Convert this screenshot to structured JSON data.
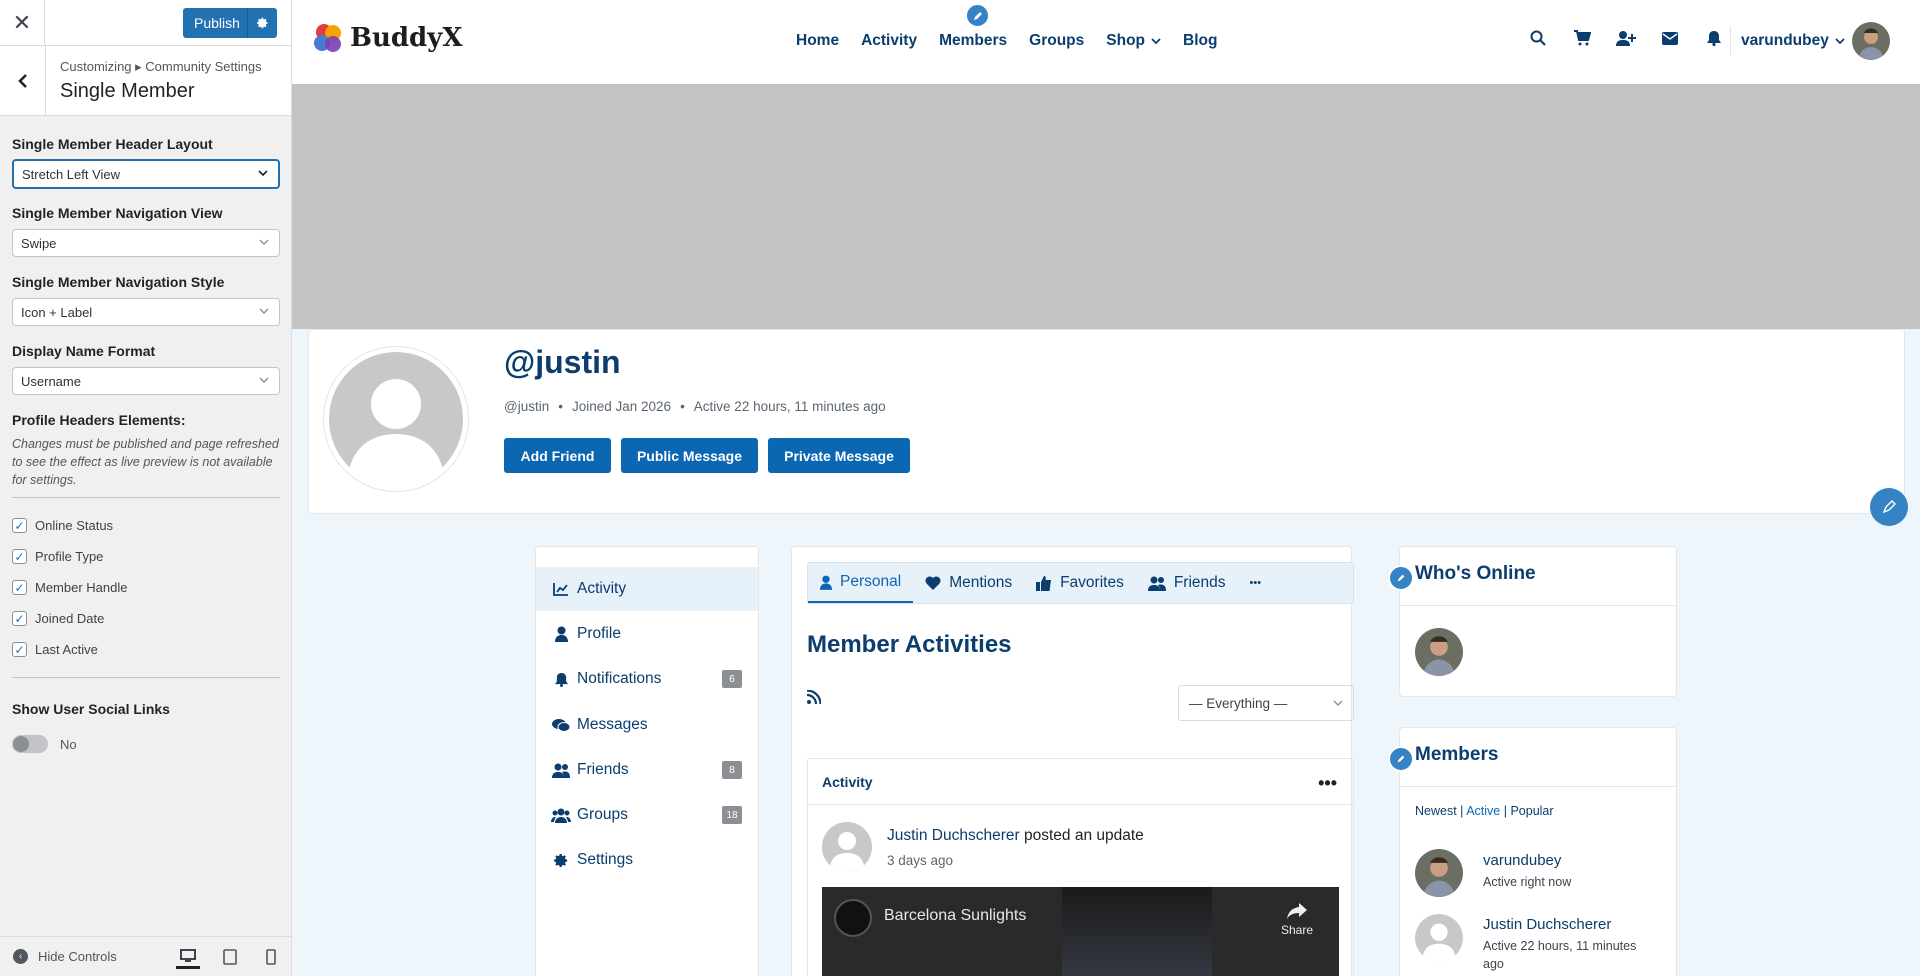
{
  "customizer": {
    "publish_label": "Publish",
    "breadcrumb": "Customizing ▸ Community Settings",
    "section_title": "Single Member",
    "fields": [
      {
        "label": "Single Member Header Layout",
        "value": "Stretch Left View"
      },
      {
        "label": "Single Member Navigation View",
        "value": "Swipe"
      },
      {
        "label": "Single Member Navigation Style",
        "value": "Icon + Label"
      },
      {
        "label": "Display Name Format",
        "value": "Username"
      }
    ],
    "profile_headers_label": "Profile Headers Elements:",
    "profile_headers_note": "Changes must be published and page refreshed to see the effect as live preview is not available for settings.",
    "checkboxes": [
      {
        "label": "Online Status",
        "checked": true
      },
      {
        "label": "Profile Type",
        "checked": true
      },
      {
        "label": "Member Handle",
        "checked": true
      },
      {
        "label": "Joined Date",
        "checked": true
      },
      {
        "label": "Last Active",
        "checked": true
      }
    ],
    "social_links_label": "Show User Social Links",
    "social_links_value": "No",
    "hide_controls": "Hide Controls"
  },
  "site": {
    "logo_text": "BuddyX",
    "nav": [
      "Home",
      "Activity",
      "Members",
      "Groups",
      "Shop",
      "Blog"
    ],
    "username": "varundubey"
  },
  "profile": {
    "name": "@justin",
    "handle": "@justin",
    "joined": "Joined Jan 2026",
    "active": "Active 22 hours, 11 minutes ago",
    "buttons": [
      "Add Friend",
      "Public Message",
      "Private Message"
    ]
  },
  "member_nav": [
    {
      "label": "Activity",
      "count": ""
    },
    {
      "label": "Profile",
      "count": ""
    },
    {
      "label": "Notifications",
      "count": "6"
    },
    {
      "label": "Messages",
      "count": ""
    },
    {
      "label": "Friends",
      "count": "8"
    },
    {
      "label": "Groups",
      "count": "18"
    },
    {
      "label": "Settings",
      "count": ""
    }
  ],
  "activity": {
    "subtabs": [
      "Personal",
      "Mentions",
      "Favorites",
      "Friends"
    ],
    "more_label": "•••",
    "title": "Member Activities",
    "filter": "— Everything —",
    "card_title": "Activity",
    "author": "Justin Duchscherer",
    "action": " posted an update",
    "time": "3 days ago",
    "video_title": "Barcelona Sunlights",
    "video_share": "Share"
  },
  "widgets": {
    "online_title": "Who's Online",
    "members_title": "Members",
    "members_tabs": {
      "newest": "Newest",
      "active": "Active",
      "popular": "Popular"
    },
    "members": [
      {
        "name": "varundubey",
        "status": "Active right now"
      },
      {
        "name": "Justin Duchscherer",
        "status": "Active 22 hours, 11 minutes ago"
      }
    ]
  },
  "colors": {
    "primary": "#0b3d6e",
    "button": "#0b67b2",
    "wp_blue": "#2271b1"
  }
}
